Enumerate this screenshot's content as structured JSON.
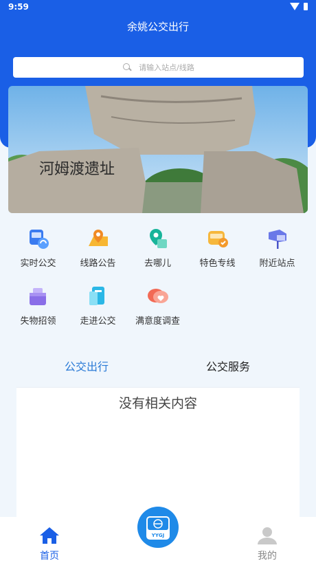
{
  "status_bar": {
    "time": "9:59"
  },
  "header": {
    "title": "余姚公交出行"
  },
  "search": {
    "placeholder": "请输入站点/线路"
  },
  "banner": {
    "caption": "河姆渡遗址"
  },
  "grid": {
    "items": [
      {
        "label": "实时公交",
        "icon": "bus-realtime-icon"
      },
      {
        "label": "线路公告",
        "icon": "route-map-icon"
      },
      {
        "label": "去哪儿",
        "icon": "destination-icon"
      },
      {
        "label": "特色专线",
        "icon": "special-bus-icon"
      },
      {
        "label": "附近站点",
        "icon": "nearby-stop-icon"
      },
      {
        "label": "失物招领",
        "icon": "lost-found-icon"
      },
      {
        "label": "走进公交",
        "icon": "about-bus-icon"
      },
      {
        "label": "满意度调查",
        "icon": "survey-icon"
      }
    ]
  },
  "tabs": {
    "travel": "公交出行",
    "service": "公交服务"
  },
  "content": {
    "empty_text": "没有相关内容"
  },
  "bottom_nav": {
    "home": "首页",
    "mine": "我的",
    "center_badge": "YYGJ"
  },
  "colors": {
    "primary": "#1a5fe6",
    "tab_active": "#2a7ad6",
    "background": "#f0f6fc"
  }
}
